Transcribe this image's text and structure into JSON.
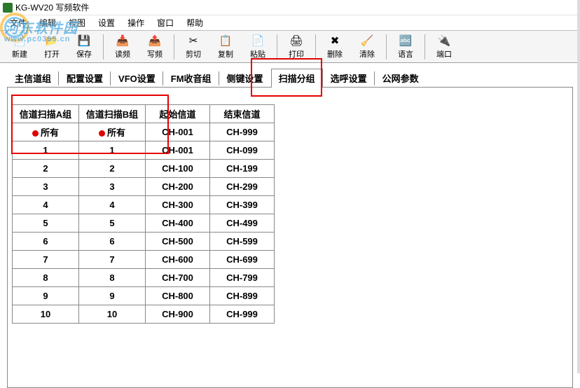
{
  "window": {
    "title": "KG-WV20 写频软件"
  },
  "menu": [
    "文件",
    "编辑",
    "视图",
    "设置",
    "操作",
    "窗口",
    "帮助"
  ],
  "toolbar": [
    {
      "id": "new",
      "label": "新建",
      "glyph": "📄"
    },
    {
      "id": "open",
      "label": "打开",
      "glyph": "📂"
    },
    {
      "id": "save",
      "label": "保存",
      "glyph": "💾"
    },
    {
      "sep": true
    },
    {
      "id": "read",
      "label": "读频",
      "glyph": "📥"
    },
    {
      "id": "write",
      "label": "写频",
      "glyph": "📤"
    },
    {
      "sep": true
    },
    {
      "id": "cut",
      "label": "剪切",
      "glyph": "✂"
    },
    {
      "id": "copy",
      "label": "复制",
      "glyph": "📋"
    },
    {
      "id": "paste",
      "label": "粘贴",
      "glyph": "📄"
    },
    {
      "sep": true
    },
    {
      "id": "print",
      "label": "打印",
      "glyph": "🖨"
    },
    {
      "sep": true
    },
    {
      "id": "delete",
      "label": "删除",
      "glyph": "✖"
    },
    {
      "id": "clear",
      "label": "清除",
      "glyph": "🧹"
    },
    {
      "sep": true
    },
    {
      "id": "lang",
      "label": "语言",
      "glyph": "🔤"
    },
    {
      "sep": true
    },
    {
      "id": "port",
      "label": "端口",
      "glyph": "🔌"
    }
  ],
  "tabs": [
    {
      "id": "main-chan",
      "label": "主信道组"
    },
    {
      "id": "config",
      "label": "配置设置"
    },
    {
      "id": "vfo",
      "label": "VFO设置"
    },
    {
      "id": "fm",
      "label": "FM收音组"
    },
    {
      "id": "sidekey",
      "label": "侧键设置"
    },
    {
      "id": "scan-group",
      "label": "扫描分组",
      "active": true
    },
    {
      "id": "selcall",
      "label": "选呼设置"
    },
    {
      "id": "pubnet",
      "label": "公网参数"
    }
  ],
  "table": {
    "headers": [
      "信道扫描A组",
      "信道扫描B组",
      "起始信道",
      "结束信道"
    ],
    "rows": [
      {
        "a": "所有",
        "b": "所有",
        "start": "CH-001",
        "end": "CH-999",
        "dot": true
      },
      {
        "a": "1",
        "b": "1",
        "start": "CH-001",
        "end": "CH-099"
      },
      {
        "a": "2",
        "b": "2",
        "start": "CH-100",
        "end": "CH-199"
      },
      {
        "a": "3",
        "b": "3",
        "start": "CH-200",
        "end": "CH-299"
      },
      {
        "a": "4",
        "b": "4",
        "start": "CH-300",
        "end": "CH-399"
      },
      {
        "a": "5",
        "b": "5",
        "start": "CH-400",
        "end": "CH-499"
      },
      {
        "a": "6",
        "b": "6",
        "start": "CH-500",
        "end": "CH-599"
      },
      {
        "a": "7",
        "b": "7",
        "start": "CH-600",
        "end": "CH-699"
      },
      {
        "a": "8",
        "b": "8",
        "start": "CH-700",
        "end": "CH-799"
      },
      {
        "a": "9",
        "b": "9",
        "start": "CH-800",
        "end": "CH-899"
      },
      {
        "a": "10",
        "b": "10",
        "start": "CH-900",
        "end": "CH-999"
      }
    ]
  },
  "watermark": {
    "main": "河东软件园",
    "url": "www.pc0359.cn"
  }
}
